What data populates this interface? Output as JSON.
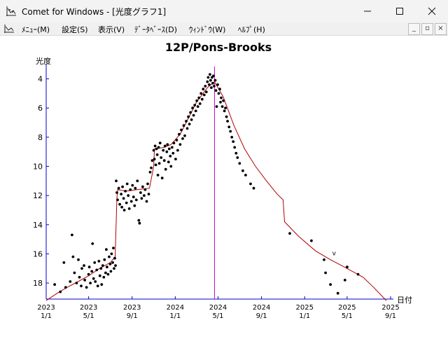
{
  "window": {
    "title": "Comet for Windows - [光度グラフ1]",
    "minimize_icon": "minimize-icon",
    "maximize_icon": "maximize-icon",
    "close_icon": "close-icon"
  },
  "menu": {
    "items": [
      {
        "label": "ﾒﾆｭｰ(M)"
      },
      {
        "label": "設定(S)"
      },
      {
        "label": "表示(V)"
      },
      {
        "label": "ﾃﾞｰﾀﾍﾞｰｽ(D)"
      },
      {
        "label": "ｳｨﾝﾄﾞｳ(W)"
      },
      {
        "label": "ﾍﾙﾌﾟ(H)"
      }
    ],
    "mdi_buttons": [
      "_",
      "▫",
      "×"
    ]
  },
  "chart_data": {
    "type": "scatter",
    "title": "12P/Pons-Brooks",
    "ylabel": "光度",
    "xlabel": "日付",
    "y_axis": {
      "inverted": true,
      "range": [
        19.1,
        3.3
      ],
      "ticks": [
        4,
        6,
        8,
        10,
        12,
        14,
        16,
        18
      ]
    },
    "x_axis": {
      "range": [
        "2023-01-01",
        "2025-09-01"
      ],
      "ticks": [
        {
          "date": "2023-01-01",
          "year": "2023",
          "md": "1/1"
        },
        {
          "date": "2023-05-01",
          "year": "2023",
          "md": "5/1"
        },
        {
          "date": "2023-09-01",
          "year": "2023",
          "md": "9/1"
        },
        {
          "date": "2024-01-01",
          "year": "2024",
          "md": "1/1"
        },
        {
          "date": "2024-05-01",
          "year": "2024",
          "md": "5/1"
        },
        {
          "date": "2024-09-01",
          "year": "2024",
          "md": "9/1"
        },
        {
          "date": "2025-01-01",
          "year": "2025",
          "md": "1/1"
        },
        {
          "date": "2025-05-01",
          "year": "2025",
          "md": "5/1"
        },
        {
          "date": "2025-09-01",
          "year": "2025",
          "md": "9/1"
        }
      ]
    },
    "perihelion_date": "2024-04-21",
    "marker_label": {
      "text": "v",
      "date": "2025-03-20",
      "mag": 16.1
    },
    "colors": {
      "axis": "#0000cc",
      "predicted": "#b00000",
      "observed": "#000000",
      "perihelion": "#cc00cc"
    },
    "predicted_curve": [
      {
        "date": "2023-01-01",
        "mag": 19.2
      },
      {
        "date": "2023-02-01",
        "mag": 18.7
      },
      {
        "date": "2023-03-01",
        "mag": 18.3
      },
      {
        "date": "2023-04-01",
        "mag": 17.9
      },
      {
        "date": "2023-05-01",
        "mag": 17.5
      },
      {
        "date": "2023-06-01",
        "mag": 17.0
      },
      {
        "date": "2023-07-01",
        "mag": 16.6
      },
      {
        "date": "2023-07-15",
        "mag": 16.2
      },
      {
        "date": "2023-07-20",
        "mag": 12.2
      },
      {
        "date": "2023-07-22",
        "mag": 11.6
      },
      {
        "date": "2023-08-15",
        "mag": 11.7
      },
      {
        "date": "2023-09-15",
        "mag": 11.6
      },
      {
        "date": "2023-10-20",
        "mag": 11.5
      },
      {
        "date": "2023-11-01",
        "mag": 10.0
      },
      {
        "date": "2023-11-03",
        "mag": 8.8
      },
      {
        "date": "2023-12-01",
        "mag": 8.7
      },
      {
        "date": "2023-12-20",
        "mag": 8.5
      },
      {
        "date": "2024-01-15",
        "mag": 7.8
      },
      {
        "date": "2024-02-01",
        "mag": 7.0
      },
      {
        "date": "2024-03-01",
        "mag": 5.6
      },
      {
        "date": "2024-04-01",
        "mag": 4.6
      },
      {
        "date": "2024-04-21",
        "mag": 4.2
      },
      {
        "date": "2024-05-15",
        "mag": 5.2
      },
      {
        "date": "2024-06-15",
        "mag": 7.2
      },
      {
        "date": "2024-07-15",
        "mag": 8.8
      },
      {
        "date": "2024-08-15",
        "mag": 10.0
      },
      {
        "date": "2024-09-15",
        "mag": 11.0
      },
      {
        "date": "2024-10-15",
        "mag": 11.9
      },
      {
        "date": "2024-11-01",
        "mag": 12.3
      },
      {
        "date": "2024-11-05",
        "mag": 13.8
      },
      {
        "date": "2024-12-15",
        "mag": 14.8
      },
      {
        "date": "2025-02-01",
        "mag": 15.8
      },
      {
        "date": "2025-03-15",
        "mag": 16.4
      },
      {
        "date": "2025-05-01",
        "mag": 17.0
      },
      {
        "date": "2025-06-15",
        "mag": 17.6
      },
      {
        "date": "2025-07-15",
        "mag": 18.3
      },
      {
        "date": "2025-08-20",
        "mag": 19.2
      }
    ],
    "observations": [
      [
        "2023-01-25",
        18.1
      ],
      [
        "2023-02-10",
        18.6
      ],
      [
        "2023-02-20",
        16.6
      ],
      [
        "2023-02-25",
        18.3
      ],
      [
        "2023-03-10",
        17.9
      ],
      [
        "2023-03-15",
        14.7
      ],
      [
        "2023-03-18",
        16.2
      ],
      [
        "2023-03-22",
        17.3
      ],
      [
        "2023-03-28",
        18.0
      ],
      [
        "2023-04-02",
        16.4
      ],
      [
        "2023-04-05",
        17.6
      ],
      [
        "2023-04-10",
        18.2
      ],
      [
        "2023-04-12",
        17.0
      ],
      [
        "2023-04-18",
        16.8
      ],
      [
        "2023-04-20",
        17.8
      ],
      [
        "2023-04-25",
        18.3
      ],
      [
        "2023-05-01",
        17.4
      ],
      [
        "2023-05-03",
        16.9
      ],
      [
        "2023-05-06",
        18.0
      ],
      [
        "2023-05-10",
        17.2
      ],
      [
        "2023-05-12",
        15.3
      ],
      [
        "2023-05-15",
        17.7
      ],
      [
        "2023-05-18",
        16.6
      ],
      [
        "2023-05-20",
        17.9
      ],
      [
        "2023-05-24",
        17.1
      ],
      [
        "2023-05-27",
        18.2
      ],
      [
        "2023-05-30",
        16.5
      ],
      [
        "2023-06-02",
        17.5
      ],
      [
        "2023-06-05",
        17.0
      ],
      [
        "2023-06-07",
        18.1
      ],
      [
        "2023-06-10",
        16.8
      ],
      [
        "2023-06-13",
        17.6
      ],
      [
        "2023-06-15",
        16.4
      ],
      [
        "2023-06-18",
        17.3
      ],
      [
        "2023-06-20",
        15.7
      ],
      [
        "2023-06-22",
        16.9
      ],
      [
        "2023-06-25",
        17.4
      ],
      [
        "2023-06-28",
        16.2
      ],
      [
        "2023-07-01",
        16.7
      ],
      [
        "2023-07-03",
        17.2
      ],
      [
        "2023-07-05",
        16.0
      ],
      [
        "2023-07-08",
        16.6
      ],
      [
        "2023-07-10",
        15.6
      ],
      [
        "2023-07-12",
        17.0
      ],
      [
        "2023-07-14",
        16.3
      ],
      [
        "2023-07-16",
        16.8
      ],
      [
        "2023-07-18",
        11.0
      ],
      [
        "2023-07-20",
        11.8
      ],
      [
        "2023-07-22",
        12.3
      ],
      [
        "2023-07-25",
        11.5
      ],
      [
        "2023-07-28",
        12.6
      ],
      [
        "2023-08-01",
        11.9
      ],
      [
        "2023-08-03",
        12.8
      ],
      [
        "2023-08-05",
        11.4
      ],
      [
        "2023-08-08",
        12.2
      ],
      [
        "2023-08-10",
        13.0
      ],
      [
        "2023-08-13",
        11.7
      ],
      [
        "2023-08-16",
        12.5
      ],
      [
        "2023-08-18",
        11.2
      ],
      [
        "2023-08-21",
        12.0
      ],
      [
        "2023-08-24",
        12.9
      ],
      [
        "2023-08-27",
        11.6
      ],
      [
        "2023-08-30",
        12.4
      ],
      [
        "2023-09-02",
        11.3
      ],
      [
        "2023-09-05",
        12.1
      ],
      [
        "2023-09-08",
        12.7
      ],
      [
        "2023-09-10",
        11.5
      ],
      [
        "2023-09-13",
        12.3
      ],
      [
        "2023-09-16",
        11.0
      ],
      [
        "2023-09-20",
        13.7
      ],
      [
        "2023-09-22",
        13.9
      ],
      [
        "2023-09-25",
        11.8
      ],
      [
        "2023-09-28",
        12.2
      ],
      [
        "2023-10-01",
        11.4
      ],
      [
        "2023-10-05",
        12.0
      ],
      [
        "2023-10-08",
        11.6
      ],
      [
        "2023-10-12",
        12.4
      ],
      [
        "2023-10-15",
        11.2
      ],
      [
        "2023-10-18",
        11.9
      ],
      [
        "2023-10-22",
        10.4
      ],
      [
        "2023-10-25",
        10.1
      ],
      [
        "2023-10-28",
        9.6
      ],
      [
        "2023-11-01",
        8.9
      ],
      [
        "2023-11-03",
        9.5
      ],
      [
        "2023-11-05",
        8.6
      ],
      [
        "2023-11-07",
        9.9
      ],
      [
        "2023-11-09",
        8.8
      ],
      [
        "2023-11-11",
        9.2
      ],
      [
        "2023-11-13",
        10.6
      ],
      [
        "2023-11-15",
        8.7
      ],
      [
        "2023-11-17",
        9.8
      ],
      [
        "2023-11-19",
        8.4
      ],
      [
        "2023-11-22",
        9.4
      ],
      [
        "2023-11-25",
        10.8
      ],
      [
        "2023-11-28",
        8.9
      ],
      [
        "2023-12-01",
        9.6
      ],
      [
        "2023-12-03",
        8.6
      ],
      [
        "2023-12-05",
        10.2
      ],
      [
        "2023-12-08",
        9.0
      ],
      [
        "2023-12-10",
        8.5
      ],
      [
        "2023-12-13",
        9.7
      ],
      [
        "2023-12-15",
        8.8
      ],
      [
        "2023-12-18",
        9.3
      ],
      [
        "2023-12-20",
        10.0
      ],
      [
        "2023-12-23",
        8.7
      ],
      [
        "2023-12-26",
        9.1
      ],
      [
        "2023-12-28",
        8.4
      ],
      [
        "2024-01-02",
        9.5
      ],
      [
        "2024-01-05",
        8.2
      ],
      [
        "2024-01-08",
        8.9
      ],
      [
        "2024-01-12",
        7.8
      ],
      [
        "2024-01-15",
        8.5
      ],
      [
        "2024-01-18",
        7.5
      ],
      [
        "2024-01-22",
        8.1
      ],
      [
        "2024-01-25",
        7.2
      ],
      [
        "2024-01-28",
        7.9
      ],
      [
        "2024-02-01",
        6.9
      ],
      [
        "2024-02-04",
        7.4
      ],
      [
        "2024-02-07",
        6.6
      ],
      [
        "2024-02-10",
        7.1
      ],
      [
        "2024-02-13",
        6.3
      ],
      [
        "2024-02-16",
        6.8
      ],
      [
        "2024-02-19",
        6.0
      ],
      [
        "2024-02-22",
        6.5
      ],
      [
        "2024-02-25",
        5.8
      ],
      [
        "2024-02-28",
        6.2
      ],
      [
        "2024-03-02",
        5.5
      ],
      [
        "2024-03-05",
        5.9
      ],
      [
        "2024-03-08",
        5.3
      ],
      [
        "2024-03-11",
        5.7
      ],
      [
        "2024-03-14",
        5.0
      ],
      [
        "2024-03-17",
        5.4
      ],
      [
        "2024-03-20",
        4.7
      ],
      [
        "2024-03-23",
        5.1
      ],
      [
        "2024-03-26",
        4.5
      ],
      [
        "2024-03-29",
        4.9
      ],
      [
        "2024-04-01",
        4.2
      ],
      [
        "2024-04-03",
        3.9
      ],
      [
        "2024-04-06",
        4.4
      ],
      [
        "2024-04-08",
        3.7
      ],
      [
        "2024-04-10",
        4.1
      ],
      [
        "2024-04-12",
        4.6
      ],
      [
        "2024-04-14",
        3.9
      ],
      [
        "2024-04-16",
        4.3
      ],
      [
        "2024-04-18",
        3.8
      ],
      [
        "2024-04-20",
        4.5
      ],
      [
        "2024-04-23",
        4.1
      ],
      [
        "2024-04-25",
        4.8
      ],
      [
        "2024-04-27",
        5.9
      ],
      [
        "2024-04-30",
        4.4
      ],
      [
        "2024-05-03",
        5.0
      ],
      [
        "2024-05-06",
        4.7
      ],
      [
        "2024-05-08",
        5.6
      ],
      [
        "2024-05-10",
        5.3
      ],
      [
        "2024-05-13",
        5.9
      ],
      [
        "2024-05-16",
        5.5
      ],
      [
        "2024-05-19",
        6.2
      ],
      [
        "2024-05-22",
        6.0
      ],
      [
        "2024-05-25",
        6.6
      ],
      [
        "2024-05-28",
        6.9
      ],
      [
        "2024-06-01",
        7.3
      ],
      [
        "2024-06-05",
        7.6
      ],
      [
        "2024-06-09",
        8.0
      ],
      [
        "2024-06-13",
        8.3
      ],
      [
        "2024-06-17",
        8.7
      ],
      [
        "2024-06-21",
        9.1
      ],
      [
        "2024-06-25",
        9.4
      ],
      [
        "2024-07-01",
        9.8
      ],
      [
        "2024-07-10",
        10.3
      ],
      [
        "2024-07-18",
        10.6
      ],
      [
        "2024-08-01",
        11.2
      ],
      [
        "2024-08-10",
        11.5
      ],
      [
        "2024-11-20",
        14.6
      ],
      [
        "2025-01-20",
        15.1
      ],
      [
        "2025-02-25",
        16.4
      ],
      [
        "2025-03-01",
        17.3
      ],
      [
        "2025-03-15",
        18.1
      ],
      [
        "2025-04-05",
        18.7
      ],
      [
        "2025-04-25",
        17.8
      ],
      [
        "2025-05-01",
        16.9
      ],
      [
        "2025-06-01",
        17.4
      ]
    ]
  }
}
